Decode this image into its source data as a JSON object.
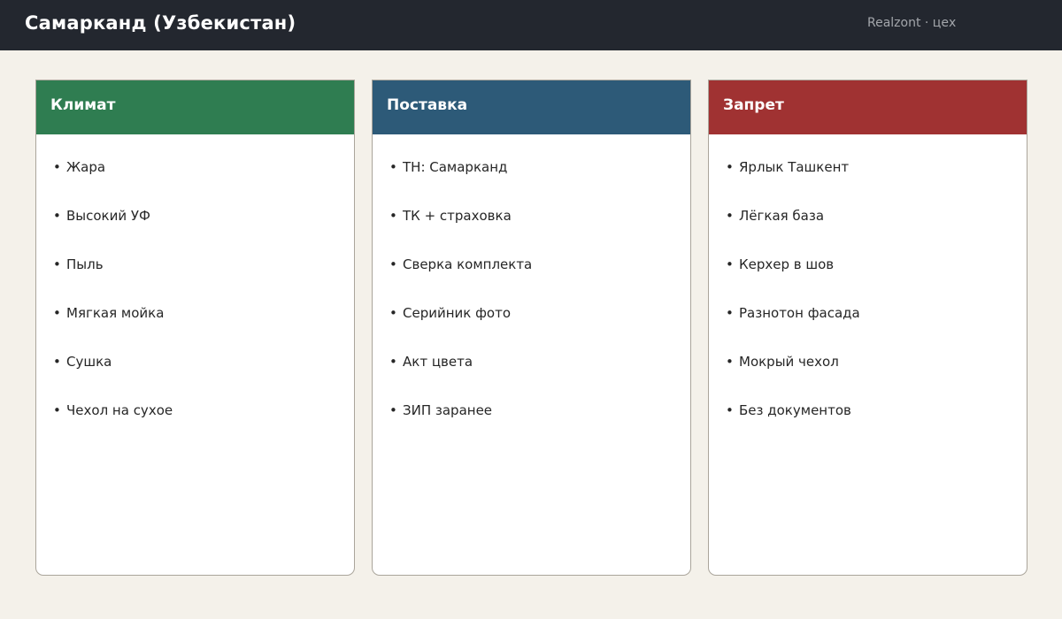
{
  "header": {
    "title": "Самарканд (Узбекистан)",
    "brand": "Realzont · цех"
  },
  "cards": [
    {
      "title": "Климат",
      "color": "#2f7d51",
      "items": [
        "Жара",
        "Высокий УФ",
        "Пыль",
        "Мягкая мойка",
        "Сушка",
        "Чехол на сухое"
      ]
    },
    {
      "title": "Поставка",
      "color": "#2d5a78",
      "items": [
        "ТН: Самарканд",
        "ТК + страховка",
        "Сверка комплекта",
        "Серийник фото",
        "Акт цвета",
        "ЗИП заранее"
      ]
    },
    {
      "title": "Запрет",
      "color": "#a03232",
      "items": [
        "Ярлык Ташкент",
        "Лёгкая база",
        "Керхер в шов",
        "Разнотон фасада",
        "Мокрый чехол",
        "Без документов"
      ]
    }
  ]
}
